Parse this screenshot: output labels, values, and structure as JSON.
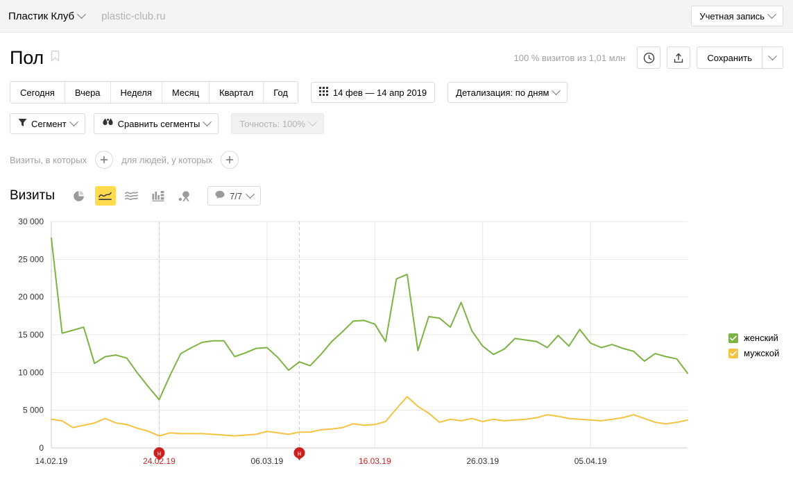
{
  "topbar": {
    "counter_name": "Пластик Клуб",
    "counter_domain": "plastic-club.ru",
    "account_label": "Учетная запись"
  },
  "page": {
    "title": "Пол",
    "visits_info": "100 % визитов из 1,01 млн",
    "save_label": "Сохранить"
  },
  "periods": [
    {
      "label": "Сегодня"
    },
    {
      "label": "Вчера"
    },
    {
      "label": "Неделя"
    },
    {
      "label": "Месяц"
    },
    {
      "label": "Квартал"
    },
    {
      "label": "Год"
    }
  ],
  "date_range": "14 фев — 14 апр 2019",
  "detail_label": "Детализация: по дням",
  "segment": {
    "segment_label": "Сегмент",
    "compare_label": "Сравнить сегменты",
    "accuracy_label": "Точность: 100%"
  },
  "filters": {
    "visits_label": "Визиты, в которых",
    "people_label": "для людей, у которых"
  },
  "chart_toolbar": {
    "metric_label": "Визиты",
    "comment_count": "7/7",
    "views": [
      {
        "name": "pie-chart-view"
      },
      {
        "name": "line-chart-view"
      },
      {
        "name": "area-chart-view"
      },
      {
        "name": "bar-chart-view"
      },
      {
        "name": "map-view"
      }
    ]
  },
  "colors": {
    "female": "#7cb342",
    "male": "#f5c342",
    "accent": "#ffdb4d",
    "holiday": "#cc1f1f",
    "grid": "#e8e6e3",
    "axis_text": "#333333",
    "muted_text": "#a3a19e"
  },
  "chart_data": {
    "type": "line",
    "title": "Визиты",
    "xlabel": "",
    "ylabel": "Визиты",
    "ylim": [
      0,
      30000
    ],
    "ytick_labels": [
      "0",
      "5 000",
      "10 000",
      "15 000",
      "20 000",
      "25 000",
      "30 000"
    ],
    "ytick_values": [
      0,
      5000,
      10000,
      15000,
      20000,
      25000,
      30000
    ],
    "grid": true,
    "legend_position": "right",
    "x_tick_labels": [
      {
        "label": "14.02.19",
        "index": 0,
        "weekend": false
      },
      {
        "label": "24.02.19",
        "index": 10,
        "weekend": true
      },
      {
        "label": "06.03.19",
        "index": 20,
        "weekend": false
      },
      {
        "label": "16.03.19",
        "index": 30,
        "weekend": true
      },
      {
        "label": "26.03.19",
        "index": 40,
        "weekend": false
      },
      {
        "label": "05.04.19",
        "index": 50,
        "weekend": false
      }
    ],
    "annotations": [
      {
        "label": "н",
        "index": 10,
        "title": "24.02.19"
      },
      {
        "label": "н",
        "index": 23,
        "title": "09.03.19"
      }
    ],
    "x": [
      "14.02.19",
      "15.02.19",
      "16.02.19",
      "17.02.19",
      "18.02.19",
      "19.02.19",
      "20.02.19",
      "21.02.19",
      "22.02.19",
      "23.02.19",
      "24.02.19",
      "25.02.19",
      "26.02.19",
      "27.02.19",
      "28.02.19",
      "01.03.19",
      "02.03.19",
      "03.03.19",
      "04.03.19",
      "05.03.19",
      "06.03.19",
      "07.03.19",
      "08.03.19",
      "09.03.19",
      "10.03.19",
      "11.03.19",
      "12.03.19",
      "13.03.19",
      "14.03.19",
      "15.03.19",
      "16.03.19",
      "17.03.19",
      "18.03.19",
      "19.03.19",
      "20.03.19",
      "21.03.19",
      "22.03.19",
      "23.03.19",
      "24.03.19",
      "25.03.19",
      "26.03.19",
      "27.03.19",
      "28.03.19",
      "29.03.19",
      "30.03.19",
      "31.03.19",
      "01.04.19",
      "02.04.19",
      "03.04.19",
      "04.04.19",
      "05.04.19",
      "06.04.19",
      "07.04.19",
      "08.04.19",
      "09.04.19",
      "10.04.19",
      "11.04.19",
      "12.04.19",
      "13.04.19",
      "14.04.19"
    ],
    "series": [
      {
        "name": "женский",
        "color": "#7cb342",
        "checked": true,
        "values": [
          27800,
          15200,
          15600,
          16000,
          11200,
          12100,
          12300,
          11900,
          9900,
          8100,
          6400,
          9600,
          12500,
          13300,
          14000,
          14200,
          14200,
          12100,
          12600,
          13200,
          13300,
          12000,
          10300,
          11400,
          10900,
          12400,
          14100,
          15400,
          16800,
          16900,
          16400,
          14100,
          22400,
          23000,
          12900,
          17400,
          17200,
          16000,
          19300,
          15500,
          13500,
          12400,
          13100,
          14500,
          14300,
          14100,
          13300,
          14900,
          13500,
          15700,
          13900,
          13300,
          13700,
          13200,
          12800,
          11500,
          12500,
          12100,
          11800,
          9900
        ]
      },
      {
        "name": "мужской",
        "color": "#f5c342",
        "checked": true,
        "values": [
          3800,
          3600,
          2700,
          3000,
          3300,
          3900,
          3300,
          3100,
          2600,
          2200,
          1600,
          2000,
          1900,
          1900,
          1900,
          1800,
          1700,
          1600,
          1700,
          1800,
          2200,
          2000,
          1800,
          2100,
          2100,
          2400,
          2500,
          2700,
          3200,
          3000,
          3100,
          3500,
          5200,
          6800,
          5500,
          4600,
          3400,
          3800,
          3600,
          3900,
          3500,
          3800,
          3600,
          3700,
          3800,
          4000,
          4400,
          4200,
          3900,
          3800,
          3700,
          3600,
          3800,
          4000,
          4400,
          3900,
          3400,
          3200,
          3400,
          3700
        ]
      }
    ]
  },
  "legend": {
    "items": [
      {
        "label": "женский",
        "color": "#7cb342"
      },
      {
        "label": "мужской",
        "color": "#f5c342"
      }
    ]
  }
}
